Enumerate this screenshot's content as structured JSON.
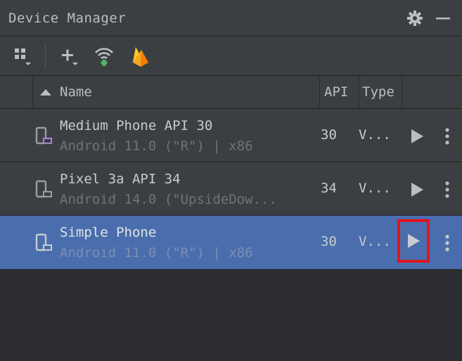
{
  "panel": {
    "title": "Device Manager",
    "icons": [
      "gear-icon",
      "minimize-icon"
    ]
  },
  "toolbar": {
    "items": [
      "device-group-icon",
      "add-icon",
      "wifi-pair-icon",
      "firebase-icon"
    ]
  },
  "table": {
    "columns": {
      "name": "Name",
      "api": "API",
      "type": "Type"
    },
    "sort_column": "Name",
    "rows": [
      {
        "name": "Medium Phone API 30",
        "subtitle": "Android 11.0 (\"R\") | x86",
        "api": "30",
        "type": "V..."
      },
      {
        "name": "Pixel 3a API 34",
        "subtitle": "Android 14.0 (\"UpsideDow...",
        "api": "34",
        "type": "V..."
      },
      {
        "name": "Simple Phone",
        "subtitle": "Android 11.0 (\"R\") | x86",
        "api": "30",
        "type": "V...",
        "selected": true
      }
    ]
  },
  "colors": {
    "selection": "#4a6ead",
    "highlight_box": "#e0151f",
    "firebase": "#f5a623"
  }
}
